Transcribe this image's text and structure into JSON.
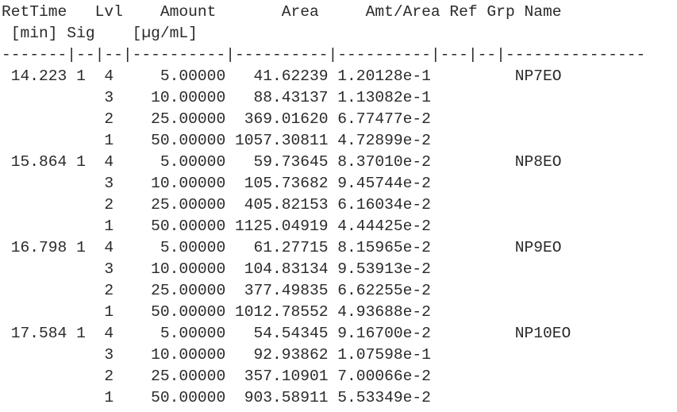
{
  "report": {
    "type": "calibration-table",
    "monospace": true,
    "header": {
      "line1_cells": [
        "RetTime",
        "Lvl",
        "Amount",
        "Area",
        "Amt/Area",
        "Ref",
        "Grp",
        "Name"
      ],
      "line2_cells": [
        "[min]",
        "Sig",
        "[µg/mL]",
        "",
        "",
        "",
        "",
        ""
      ],
      "line1": "RetTime   Lvl    Amount       Area     Amt/Area Ref Grp Name",
      "line2": " [min] Sig    [µg/mL]"
    },
    "separator": "-------|--|--|----------|----------|----------|---|--|---------------",
    "columns": [
      {
        "key": "rettime",
        "label": "RetTime",
        "unit": "[min]",
        "width": 7,
        "align": "right"
      },
      {
        "key": "sig",
        "label": "Sig",
        "unit": "",
        "width": 2,
        "align": "right"
      },
      {
        "key": "lvl",
        "label": "Lvl",
        "unit": "",
        "width": 2,
        "align": "right"
      },
      {
        "key": "amount",
        "label": "Amount",
        "unit": "[µg/mL]",
        "width": 10,
        "align": "right"
      },
      {
        "key": "area",
        "label": "Area",
        "unit": "",
        "width": 10,
        "align": "right"
      },
      {
        "key": "amt_area",
        "label": "Amt/Area",
        "unit": "",
        "width": 10,
        "align": "right"
      },
      {
        "key": "ref",
        "label": "Ref",
        "unit": "",
        "width": 3,
        "align": "left"
      },
      {
        "key": "grp",
        "label": "Grp",
        "unit": "",
        "width": 2,
        "align": "left"
      },
      {
        "key": "name",
        "label": "Name",
        "unit": "",
        "width": 15,
        "align": "left"
      }
    ],
    "rows": [
      {
        "rettime": "14.223",
        "sig": "1",
        "lvl": "4",
        "amount": "5.00000",
        "area": "41.62239",
        "amt_area": "1.20128e-1",
        "ref": "",
        "grp": "",
        "name": "NP7EO"
      },
      {
        "rettime": "",
        "sig": "",
        "lvl": "3",
        "amount": "10.00000",
        "area": "88.43137",
        "amt_area": "1.13082e-1",
        "ref": "",
        "grp": "",
        "name": ""
      },
      {
        "rettime": "",
        "sig": "",
        "lvl": "2",
        "amount": "25.00000",
        "area": "369.01620",
        "amt_area": "6.77477e-2",
        "ref": "",
        "grp": "",
        "name": ""
      },
      {
        "rettime": "",
        "sig": "",
        "lvl": "1",
        "amount": "50.00000",
        "area": "1057.30811",
        "amt_area": "4.72899e-2",
        "ref": "",
        "grp": "",
        "name": ""
      },
      {
        "rettime": "15.864",
        "sig": "1",
        "lvl": "4",
        "amount": "5.00000",
        "area": "59.73645",
        "amt_area": "8.37010e-2",
        "ref": "",
        "grp": "",
        "name": "NP8EO"
      },
      {
        "rettime": "",
        "sig": "",
        "lvl": "3",
        "amount": "10.00000",
        "area": "105.73682",
        "amt_area": "9.45744e-2",
        "ref": "",
        "grp": "",
        "name": ""
      },
      {
        "rettime": "",
        "sig": "",
        "lvl": "2",
        "amount": "25.00000",
        "area": "405.82153",
        "amt_area": "6.16034e-2",
        "ref": "",
        "grp": "",
        "name": ""
      },
      {
        "rettime": "",
        "sig": "",
        "lvl": "1",
        "amount": "50.00000",
        "area": "1125.04919",
        "amt_area": "4.44425e-2",
        "ref": "",
        "grp": "",
        "name": ""
      },
      {
        "rettime": "16.798",
        "sig": "1",
        "lvl": "4",
        "amount": "5.00000",
        "area": "61.27715",
        "amt_area": "8.15965e-2",
        "ref": "",
        "grp": "",
        "name": "NP9EO"
      },
      {
        "rettime": "",
        "sig": "",
        "lvl": "3",
        "amount": "10.00000",
        "area": "104.83134",
        "amt_area": "9.53913e-2",
        "ref": "",
        "grp": "",
        "name": ""
      },
      {
        "rettime": "",
        "sig": "",
        "lvl": "2",
        "amount": "25.00000",
        "area": "377.49835",
        "amt_area": "6.62255e-2",
        "ref": "",
        "grp": "",
        "name": ""
      },
      {
        "rettime": "",
        "sig": "",
        "lvl": "1",
        "amount": "50.00000",
        "area": "1012.78552",
        "amt_area": "4.93688e-2",
        "ref": "",
        "grp": "",
        "name": ""
      },
      {
        "rettime": "17.584",
        "sig": "1",
        "lvl": "4",
        "amount": "5.00000",
        "area": "54.54345",
        "amt_area": "9.16700e-2",
        "ref": "",
        "grp": "",
        "name": "NP10EO"
      },
      {
        "rettime": "",
        "sig": "",
        "lvl": "3",
        "amount": "10.00000",
        "area": "92.93862",
        "amt_area": "1.07598e-1",
        "ref": "",
        "grp": "",
        "name": ""
      },
      {
        "rettime": "",
        "sig": "",
        "lvl": "2",
        "amount": "25.00000",
        "area": "357.10901",
        "amt_area": "7.00066e-2",
        "ref": "",
        "grp": "",
        "name": ""
      },
      {
        "rettime": "",
        "sig": "",
        "lvl": "1",
        "amount": "50.00000",
        "area": "903.58911",
        "amt_area": "5.53349e-2",
        "ref": "",
        "grp": "",
        "name": ""
      }
    ],
    "rendered_lines": [
      "RetTime   Lvl    Amount       Area     Amt/Area Ref Grp Name",
      " [min] Sig    [µg/mL]",
      "-------|--|--|----------|----------|----------|---|--|---------------",
      " 14.223 1  4     5.00000   41.62239 1.20128e-1         NP7EO",
      "           3    10.00000   88.43137 1.13082e-1",
      "           2    25.00000  369.01620 6.77477e-2",
      "           1    50.00000 1057.30811 4.72899e-2",
      " 15.864 1  4     5.00000   59.73645 8.37010e-2         NP8EO",
      "           3    10.00000  105.73682 9.45744e-2",
      "           2    25.00000  405.82153 6.16034e-2",
      "           1    50.00000 1125.04919 4.44425e-2",
      " 16.798 1  4     5.00000   61.27715 8.15965e-2         NP9EO",
      "           3    10.00000  104.83134 9.53913e-2",
      "           2    25.00000  377.49835 6.62255e-2",
      "           1    50.00000 1012.78552 4.93688e-2",
      " 17.584 1  4     5.00000   54.54345 9.16700e-2         NP10EO",
      "           3    10.00000   92.93862 1.07598e-1",
      "           2    25.00000  357.10901 7.00066e-2",
      "           1    50.00000  903.58911 5.53349e-2"
    ],
    "colors": {
      "text": "#1b1b1b",
      "background": "#ffffff"
    }
  }
}
